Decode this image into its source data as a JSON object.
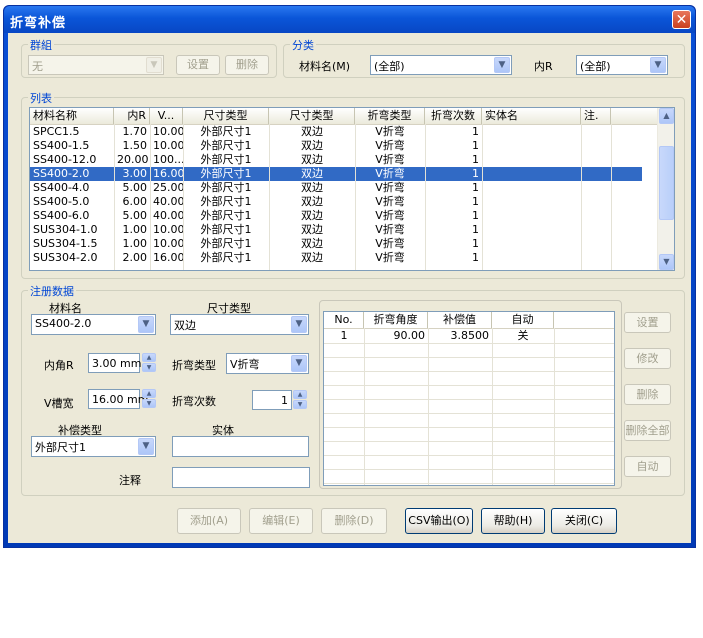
{
  "window": {
    "title": "折弯补偿",
    "close": "✕"
  },
  "group_box": {
    "label": "群組",
    "combo_value": "无",
    "set_button": "设置",
    "delete_button": "删除"
  },
  "classify_box": {
    "label": "分类",
    "material_label": "材料名(M)",
    "material_value": "(全部)",
    "inner_r_label": "内R",
    "inner_r_value": "(全部)"
  },
  "list_box": {
    "label": "列表",
    "columns": [
      "材料名称",
      "内R",
      "V...",
      "尺寸类型",
      "尺寸类型",
      "折弯类型",
      "折弯次数",
      "实体名",
      "注."
    ],
    "rows": [
      [
        "SPCC1.5",
        "1.70",
        "10.00",
        "外部尺寸1",
        "双边",
        "V折弯",
        "1",
        "",
        ""
      ],
      [
        "SS400-1.5",
        "1.50",
        "10.00",
        "外部尺寸1",
        "双边",
        "V折弯",
        "1",
        "",
        ""
      ],
      [
        "SS400-12.0",
        "20.00",
        "100...",
        "外部尺寸1",
        "双边",
        "V折弯",
        "1",
        "",
        ""
      ],
      [
        "SS400-2.0",
        "3.00",
        "16.00",
        "外部尺寸1",
        "双边",
        "V折弯",
        "1",
        "",
        ""
      ],
      [
        "SS400-4.0",
        "5.00",
        "25.00",
        "外部尺寸1",
        "双边",
        "V折弯",
        "1",
        "",
        ""
      ],
      [
        "SS400-5.0",
        "6.00",
        "40.00",
        "外部尺寸1",
        "双边",
        "V折弯",
        "1",
        "",
        ""
      ],
      [
        "SS400-6.0",
        "5.00",
        "40.00",
        "外部尺寸1",
        "双边",
        "V折弯",
        "1",
        "",
        ""
      ],
      [
        "SUS304-1.0",
        "1.00",
        "10.00",
        "外部尺寸1",
        "双边",
        "V折弯",
        "1",
        "",
        ""
      ],
      [
        "SUS304-1.5",
        "1.00",
        "10.00",
        "外部尺寸1",
        "双边",
        "V折弯",
        "1",
        "",
        ""
      ],
      [
        "SUS304-2.0",
        "2.00",
        "16.00",
        "外部尺寸1",
        "双边",
        "V折弯",
        "1",
        "",
        ""
      ]
    ],
    "selected_row": 3
  },
  "register": {
    "label": "注册数据",
    "material_label": "材料名",
    "material_value": "SS400-2.0",
    "size_type_label": "尺寸类型",
    "size_type_value": "双边",
    "inner_r_label": "内角R",
    "inner_r_value": "3.00 mm",
    "bend_type_label": "折弯类型",
    "bend_type_value": "V折弯",
    "v_width_label": "V槽宽",
    "v_width_value": "16.00 mm",
    "bend_count_label": "折弯次数",
    "bend_count_value": "1",
    "comp_type_label": "补偿类型",
    "comp_type_value": "外部尺寸1",
    "entity_label": "实体",
    "entity_value": "",
    "note_label": "注释",
    "note_value": "",
    "table": {
      "columns": [
        "No.",
        "折弯角度",
        "补偿值",
        "自动"
      ],
      "rows": [
        [
          "1",
          "90.00",
          "3.8500",
          "关"
        ]
      ]
    },
    "side_buttons": [
      "设置",
      "修改",
      "删除",
      "删除全部",
      "自动"
    ]
  },
  "footer": {
    "add": "添加(A)",
    "edit": "编辑(E)",
    "delete": "删除(D)",
    "csv": "CSV输出(O)",
    "help": "帮助(H)",
    "close": "关闭(C)"
  }
}
